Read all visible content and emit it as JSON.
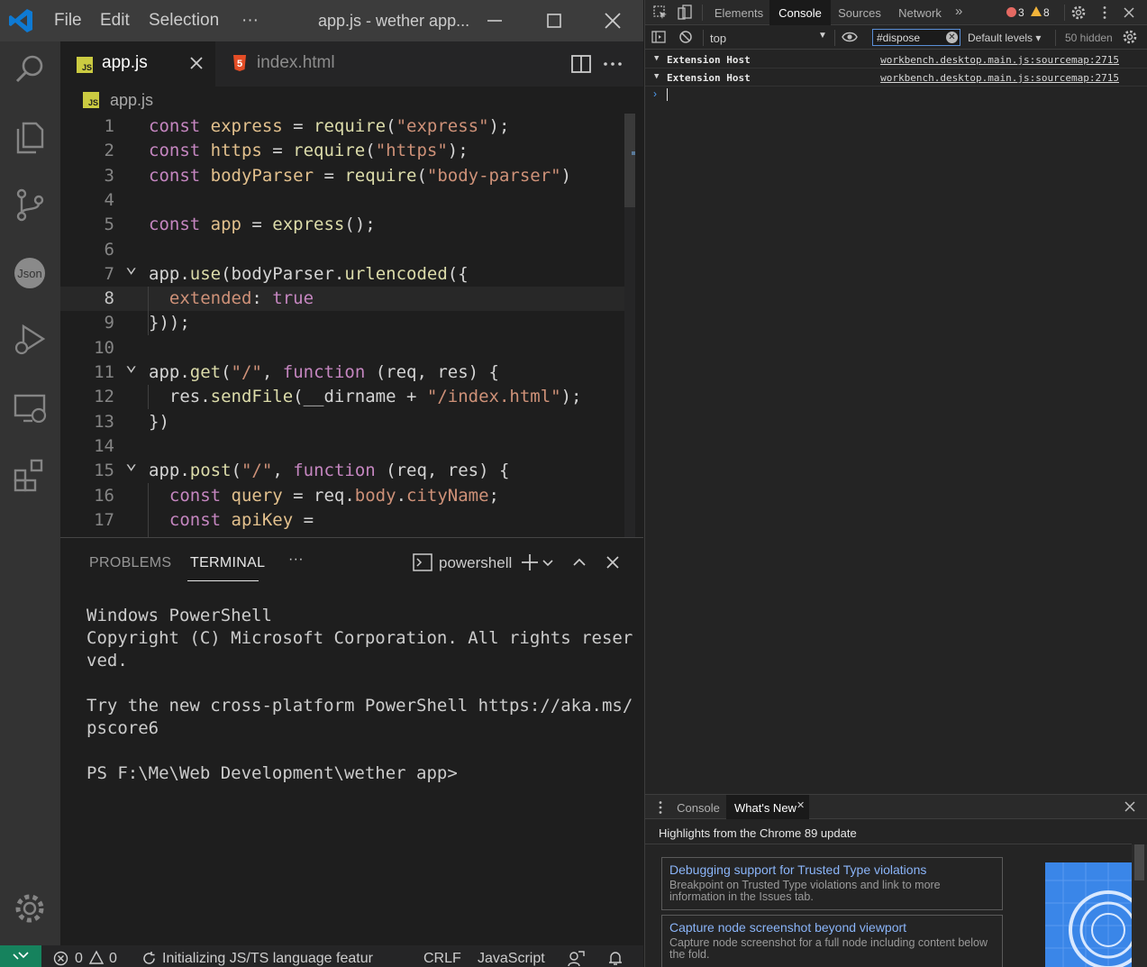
{
  "vscode": {
    "menu": [
      "File",
      "Edit",
      "Selection",
      "···"
    ],
    "window_title": "app.js - wether app...",
    "tabs": [
      {
        "label": "app.js",
        "icon": "js-file-icon",
        "active": true
      },
      {
        "label": "index.html",
        "icon": "html-file-icon",
        "active": false
      }
    ],
    "breadcrumb": "app.js",
    "code_lines": [
      {
        "n": "1",
        "tokens": [
          [
            "kw",
            "const "
          ],
          [
            "var",
            "express"
          ],
          [
            "op",
            " = "
          ],
          [
            "fn",
            "require"
          ],
          [
            "op",
            "("
          ],
          [
            "str",
            "\"express\""
          ],
          [
            "op",
            ");"
          ]
        ]
      },
      {
        "n": "2",
        "tokens": [
          [
            "kw",
            "const "
          ],
          [
            "var",
            "https"
          ],
          [
            "op",
            " = "
          ],
          [
            "fn",
            "require"
          ],
          [
            "op",
            "("
          ],
          [
            "str",
            "\"https\""
          ],
          [
            "op",
            ");"
          ]
        ]
      },
      {
        "n": "3",
        "tokens": [
          [
            "kw",
            "const "
          ],
          [
            "var",
            "bodyParser"
          ],
          [
            "op",
            " = "
          ],
          [
            "fn",
            "require"
          ],
          [
            "op",
            "("
          ],
          [
            "str",
            "\"body-parser\""
          ],
          [
            "op",
            ")"
          ]
        ]
      },
      {
        "n": "4",
        "tokens": []
      },
      {
        "n": "5",
        "tokens": [
          [
            "kw",
            "const "
          ],
          [
            "var",
            "app"
          ],
          [
            "op",
            " = "
          ],
          [
            "fn",
            "express"
          ],
          [
            "op",
            "();"
          ]
        ]
      },
      {
        "n": "6",
        "tokens": []
      },
      {
        "n": "7",
        "tokens": [
          [
            "op",
            "app."
          ],
          [
            "fn",
            "use"
          ],
          [
            "op",
            "(bodyParser."
          ],
          [
            "fn",
            "urlencoded"
          ],
          [
            "op",
            "({"
          ]
        ]
      },
      {
        "n": "8",
        "tokens": [
          [
            "str",
            "  extended"
          ],
          [
            "op",
            ": "
          ],
          [
            "kw",
            "true"
          ]
        ]
      },
      {
        "n": "9",
        "tokens": [
          [
            "op",
            "}));"
          ]
        ]
      },
      {
        "n": "10",
        "tokens": []
      },
      {
        "n": "11",
        "tokens": [
          [
            "op",
            "app."
          ],
          [
            "fn",
            "get"
          ],
          [
            "op",
            "("
          ],
          [
            "str",
            "\"/\""
          ],
          [
            "op",
            ", "
          ],
          [
            "kw",
            "function"
          ],
          [
            "op",
            " (req, res) {"
          ]
        ]
      },
      {
        "n": "12",
        "tokens": [
          [
            "op",
            "  res."
          ],
          [
            "fn",
            "sendFile"
          ],
          [
            "op",
            "(__dirname + "
          ],
          [
            "str",
            "\"/index.html\""
          ],
          [
            "op",
            ");"
          ]
        ]
      },
      {
        "n": "13",
        "tokens": [
          [
            "op",
            "})"
          ]
        ]
      },
      {
        "n": "14",
        "tokens": []
      },
      {
        "n": "15",
        "tokens": [
          [
            "op",
            "app."
          ],
          [
            "fn",
            "post"
          ],
          [
            "op",
            "("
          ],
          [
            "str",
            "\"/\""
          ],
          [
            "op",
            ", "
          ],
          [
            "kw",
            "function"
          ],
          [
            "op",
            " (req, res) {"
          ]
        ]
      },
      {
        "n": "16",
        "tokens": [
          [
            "kw",
            "  const "
          ],
          [
            "var",
            "query"
          ],
          [
            "op",
            " = req."
          ],
          [
            "str",
            "body"
          ],
          [
            "op",
            "."
          ],
          [
            "str",
            "cityName"
          ],
          [
            "op",
            ";"
          ]
        ]
      },
      {
        "n": "17",
        "tokens": [
          [
            "kw",
            "  const "
          ],
          [
            "var",
            "apiKey"
          ],
          [
            "op",
            " ="
          ]
        ]
      }
    ],
    "panel": {
      "tabs": [
        "PROBLEMS",
        "TERMINAL",
        "···"
      ],
      "shell": "powershell",
      "terminal_text": "Windows PowerShell\nCopyright (C) Microsoft Corporation. All rights reser\nved.\n\nTry the new cross-platform PowerShell https://aka.ms/\npscore6\n\nPS F:\\Me\\Web Development\\wether app>"
    },
    "status": {
      "errors": "0",
      "warnings": "0",
      "progress": "Initializing JS/TS language featur",
      "eol": "CRLF",
      "language": "JavaScript"
    }
  },
  "devtools": {
    "tabs": [
      "Elements",
      "Console",
      "Sources",
      "Network",
      "»"
    ],
    "issues": {
      "errors": "3",
      "warnings": "8"
    },
    "context": "top",
    "filter_value": "#dispose",
    "levels": "Default levels ▾",
    "hidden": "50 hidden",
    "messages": [
      {
        "group": "Extension Host",
        "source": "workbench.desktop.main.js:sourcemap:2715"
      },
      {
        "group": "Extension Host",
        "source": "workbench.desktop.main.js:sourcemap:2715"
      }
    ],
    "prompt": "›",
    "drawer": {
      "tabs": [
        "Console",
        "What's New"
      ],
      "headline": "Highlights from the Chrome 89 update",
      "cards": [
        {
          "title": "Debugging support for Trusted Type violations",
          "desc": "Breakpoint on Trusted Type violations and link to more information in the Issues tab."
        },
        {
          "title": "Capture node screenshot beyond viewport",
          "desc": "Capture node screenshot for a full node including content below the fold."
        }
      ]
    }
  },
  "colors": {
    "accent": "#007acc",
    "remote": "#16825d",
    "link": "#8ab4f8"
  }
}
